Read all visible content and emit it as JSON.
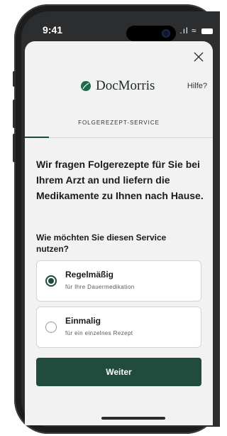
{
  "status_bar": {
    "time": "9:41",
    "icons": ".ıl ≈"
  },
  "header": {
    "brand": "DocMorris",
    "help_label": "Hilfe?",
    "close_icon": "close-icon",
    "logo_icon": "leaf-logo-icon"
  },
  "tabs": [
    {
      "label": "FOLGEREZEPT-SERVICE",
      "active": true
    }
  ],
  "content": {
    "headline": "Wir fragen Folgerezepte für Sie bei Ihrem Arzt an und liefern die Medikamente zu Ihnen nach Hause.",
    "question": "Wie möchten Sie diesen Service nutzen?"
  },
  "options": [
    {
      "title": "Regelmäßig",
      "subtitle": "für Ihre Dauermedikation",
      "selected": true
    },
    {
      "title": "Einmalig",
      "subtitle": "für ein einzelnes Rezept",
      "selected": false
    }
  ],
  "primary_button": {
    "label": "Weiter"
  },
  "colors": {
    "accent": "#214b3c",
    "sheet_bg": "#f2f2f2"
  }
}
